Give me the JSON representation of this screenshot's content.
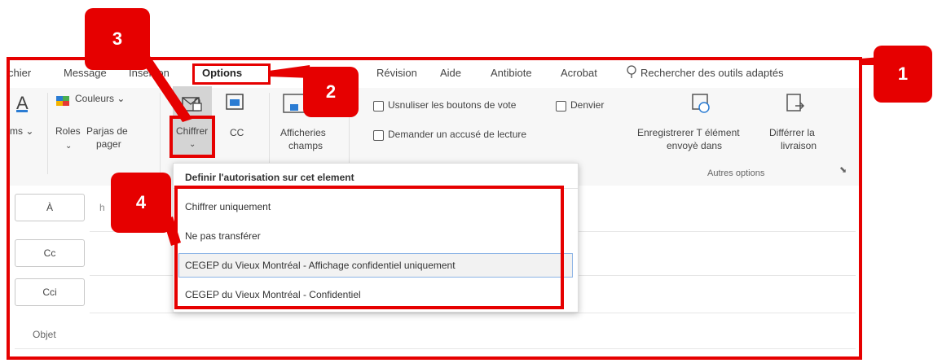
{
  "tabs": [
    "chier",
    "Message",
    "Insertion",
    "Options",
    "Révision",
    "Aide",
    "Antibiote",
    "Acrobat"
  ],
  "search_placeholder": "Rechercher des outils adaptés",
  "ribbon": {
    "themes_label": "ms",
    "roles_label": "Roles",
    "colors_label": "Couleurs",
    "pages_label": "Parjas de",
    "pages_label2": "pager",
    "encrypt_label": "Chiffrer",
    "cc_label": "CC",
    "display_label": "Afficheries",
    "display_label2": "champs",
    "vote_label": "Usnuliser les boutons de vote",
    "denier_label": "Denvier",
    "receipt_label": "Demander un accusé de lecture",
    "save_label": "Enregistrerer T élément",
    "save_label2": "envoyè dans",
    "defer_label": "Différrer la",
    "defer_label2": "livraison",
    "group_label": "Autres options"
  },
  "fields": {
    "to": "À",
    "to_hint": "h",
    "cc": "Cc",
    "bcc": "Cci",
    "subject": "Objet"
  },
  "menu": {
    "header": "Definir l'autorisation sur cet element",
    "items": [
      "Chiffrer uniquement",
      "Ne pas transférer",
      "CEGEP du Vieux Montréal - Affichage confidentiel uniquement",
      "CEGEP du Vieux Montréal - Confidentiel"
    ]
  },
  "badges": [
    "1",
    "2",
    "3",
    "4"
  ],
  "colors": {
    "annotation": "#e60000",
    "ribbon_bg": "#f7f7f7"
  }
}
